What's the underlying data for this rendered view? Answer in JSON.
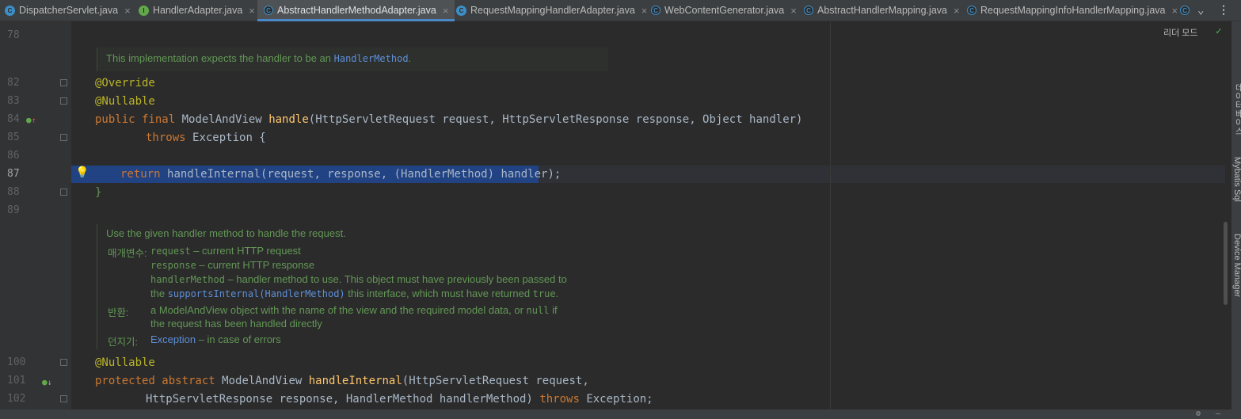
{
  "tabs": [
    {
      "label": "DispatcherServlet.java",
      "icon": "class-icon"
    },
    {
      "label": "HandlerAdapter.java",
      "icon": "interface-icon"
    },
    {
      "label": "AbstractHandlerMethodAdapter.java",
      "icon": "abstract-class-icon",
      "active": true
    },
    {
      "label": "RequestMappingHandlerAdapter.java",
      "icon": "class-icon"
    },
    {
      "label": "WebContentGenerator.java",
      "icon": "abstract-class-icon"
    },
    {
      "label": "AbstractHandlerMapping.java",
      "icon": "abstract-class-icon"
    },
    {
      "label": "RequestMappingInfoHandlerMapping.java",
      "icon": "abstract-class-icon"
    }
  ],
  "gutter": {
    "line_numbers": [
      "78",
      "82",
      "83",
      "84",
      "85",
      "86",
      "87",
      "88",
      "89",
      "100",
      "101",
      "102"
    ]
  },
  "code": {
    "l82": "@Override",
    "l83": "@Nullable",
    "l84_kw": "public final",
    "l84_type": "ModelAndView",
    "l84_fn": "handle",
    "l84_rest": "(HttpServletRequest request, HttpServletResponse response, Object handler)",
    "l85_kw": "throws",
    "l85_rest": "Exception {",
    "l87_kw": "return",
    "l87_rest": "handleInternal(request, response, (HandlerMethod) handler);",
    "l88": "}",
    "l100": "@Nullable",
    "l101_kw": "protected abstract",
    "l101_type": "ModelAndView",
    "l101_fn": "handleInternal",
    "l101_rest": "(HttpServletRequest request,",
    "l102_pre": "HttpServletResponse response, HandlerMethod handlerMethod)",
    "l102_kw": "throws",
    "l102_rest": "Exception;"
  },
  "doc1": {
    "text": "This implementation expects the handler to be an ",
    "link": "HandlerMethod",
    "end": "."
  },
  "doc2": {
    "summary": "Use the given handler method to handle the request.",
    "params_label": "매개변수:",
    "p1_name": "request",
    "p1_desc": " – current HTTP request",
    "p2_name": "response",
    "p2_desc": " – current HTTP response",
    "p3_name": "handlerMethod",
    "p3_desc": " – handler method to use. This object must have previously been passed to",
    "p3_cont_pre": "the ",
    "p3_cont_link": "supportsInternal(HandlerMethod)",
    "p3_cont_mid": " this interface, which must have returned ",
    "p3_cont_true": "true",
    "p3_cont_end": ".",
    "returns_label": "반환:",
    "returns_pre": "a ModelAndView object with the name of the view and the required model data, or ",
    "returns_null": "null",
    "returns_post": " if",
    "returns_cont": "the request has been handled directly",
    "throws_label": "던지기:",
    "throws_link": "Exception",
    "throws_desc": " – in case of errors"
  },
  "right": {
    "reader_mode": "리더 모드",
    "side_labels": [
      "데이터베이스",
      "Mybatis Sql",
      "Device Manager"
    ]
  },
  "colors": {
    "background": "#2b2b2b",
    "keyword": "#cc7832",
    "annotation": "#bbb529",
    "function": "#ffc66d",
    "doc": "#629755",
    "selection": "#214283"
  }
}
